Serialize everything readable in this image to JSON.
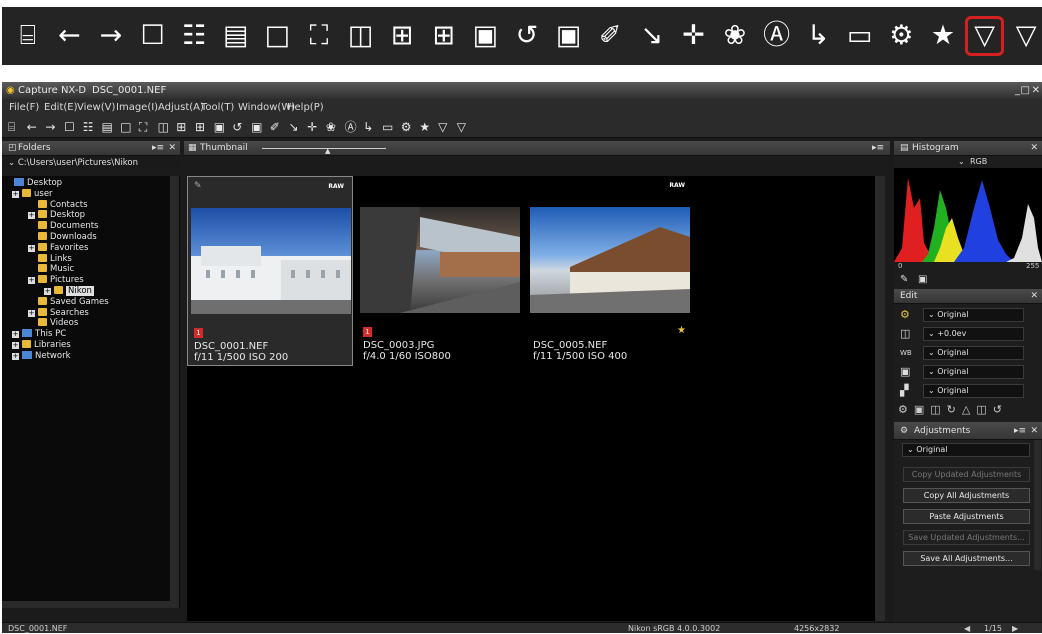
{
  "zoom_toolbar": {
    "icons": [
      "print-icon",
      "back-arrow-icon",
      "forward-arrow-icon",
      "open-folder-icon",
      "grid-view-icon",
      "filmstrip-view-icon",
      "single-view-icon",
      "full-screen-icon",
      "compare-two-icon",
      "compare-four-icon",
      "compare-split-icon",
      "compare-large-icon",
      "rotate-icon",
      "fit-icon",
      "eyedropper-icon",
      "straighten-icon",
      "crop-icon",
      "auto-retouch-icon",
      "open-with-app-icon",
      "transfer-icon",
      "slideshow-icon",
      "settings-icon",
      "star-icon",
      "filter-icon",
      "filter-partial-icon"
    ],
    "highlighted": "filter-icon",
    "highlight_color": "#d42020"
  },
  "window": {
    "app_title": "Capture NX-D",
    "document": "DSC_0001.NEF"
  },
  "menu": [
    "File(F)",
    "Edit(E)",
    "View(V)",
    "Image(I)",
    "Adjust(A)",
    "Tool(T)",
    "Window(W)",
    "Help(P)"
  ],
  "folders_panel": {
    "title": "Folders",
    "path": "C:\\Users\\user\\Pictures\\Nikon",
    "items": [
      {
        "label": "Desktop",
        "icon": "pc"
      },
      {
        "label": "user",
        "icon": "folder"
      },
      {
        "label": "Contacts",
        "icon": "folder"
      },
      {
        "label": "Desktop",
        "icon": "folder"
      },
      {
        "label": "Documents",
        "icon": "folder"
      },
      {
        "label": "Downloads",
        "icon": "folder"
      },
      {
        "label": "Favorites",
        "icon": "folder"
      },
      {
        "label": "Links",
        "icon": "folder"
      },
      {
        "label": "Music",
        "icon": "folder"
      },
      {
        "label": "Pictures",
        "icon": "folder"
      },
      {
        "label": "Nikon",
        "icon": "folder",
        "selected": true
      },
      {
        "label": "Saved Games",
        "icon": "folder"
      },
      {
        "label": "Searches",
        "icon": "folder"
      },
      {
        "label": "Videos",
        "icon": "folder"
      },
      {
        "label": "This PC",
        "icon": "pc"
      },
      {
        "label": "Libraries",
        "icon": "folder"
      },
      {
        "label": "Network",
        "icon": "pc"
      }
    ]
  },
  "thumbnail_panel": {
    "title": "Thumbnail",
    "items": [
      {
        "name": "DSC_0001.NEF",
        "exif": "f/11 1/500 ISO 200",
        "badge": "RAW",
        "label": "1",
        "selected": true
      },
      {
        "name": "DSC_0003.JPG",
        "exif": "f/4.0 1/60  ISO800",
        "badge": "",
        "label": "1"
      },
      {
        "name": "DSC_0005.NEF",
        "exif": "f/11 1/500 ISO 400",
        "badge": "RAW",
        "rating": "★"
      }
    ]
  },
  "histogram": {
    "title": "Histogram",
    "channel": "RGB",
    "min_label": "0",
    "max_label": "255"
  },
  "edit": {
    "title": "Edit",
    "rows": [
      "Original",
      "+0.0ev",
      "Original",
      "Original",
      "Original"
    ]
  },
  "adjustments": {
    "title": "Adjustments",
    "preset": "Original",
    "buttons": [
      "Copy Updated Adjustments",
      "Copy All Adjustments",
      "Paste Adjustments",
      "Save Updated Adjustments...",
      "Save All Adjustments..."
    ]
  },
  "status_bar": {
    "filename": "DSC_0001.NEF",
    "profile": "Nikon sRGB 4.0.0.3002",
    "dimensions": "4256x2832",
    "page": "1/15"
  }
}
